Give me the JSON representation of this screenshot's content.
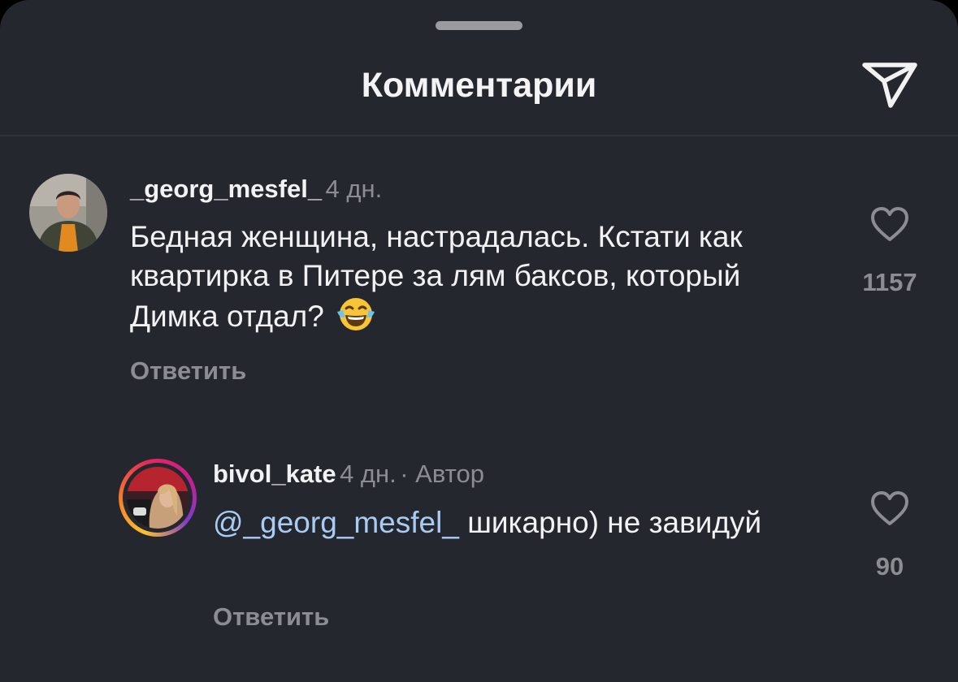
{
  "header": {
    "title": "Комментарии",
    "share_icon": "send-icon"
  },
  "comments": [
    {
      "username": "_georg_mesfel_",
      "time": "4 дн.",
      "text": "Бедная женщина, настрадалась. Кстати как квартирка в Питере за лям баксов, который Димка отдал?",
      "emoji": "tears-of-joy-emoji",
      "reply_label": "Ответить",
      "likes": "1157",
      "like_icon": "heart-icon"
    },
    {
      "username": "bivol_kate",
      "time": "4 дн.",
      "badge": "· Автор",
      "mention": "@_georg_mesfel_",
      "text": "шикарно) не завидуй",
      "reply_label": "Ответить",
      "likes": "90",
      "like_icon": "heart-icon"
    }
  ],
  "colors": {
    "background": "#25272e",
    "text": "#f2f2f4",
    "muted": "#8c8d93",
    "mention": "#a9ccf5"
  }
}
